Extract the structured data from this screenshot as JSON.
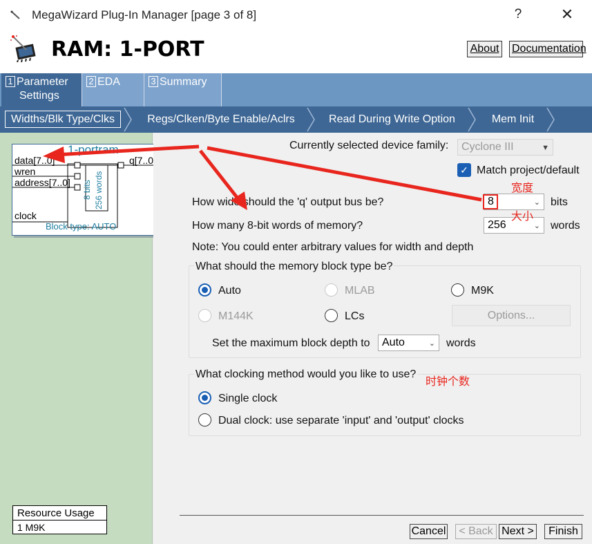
{
  "window": {
    "title": "MegaWizard Plug-In Manager [page 3 of 8]",
    "help": "?",
    "close": "✕"
  },
  "header": {
    "heading": "RAM: 1-PORT",
    "about": "About",
    "documentation": "Documentation"
  },
  "tabs": [
    {
      "num": "1",
      "label1": "Parameter",
      "label2": "Settings"
    },
    {
      "num": "2",
      "label1": "EDA"
    },
    {
      "num": "3",
      "label1": "Summary"
    }
  ],
  "subtabs": [
    "Widths/Blk Type/Clks",
    "Regs/Clken/Byte Enable/Aclrs",
    "Read During Write Option",
    "Mem Init"
  ],
  "symbol": {
    "title": "1-portram",
    "data": "data[7..0]",
    "wren": "wren",
    "address": "address[7..0]",
    "clock": "clock",
    "q": "q[7..0]",
    "bits": "8 bits",
    "words": "256 words",
    "block_type": "Block type: AUTO"
  },
  "resource": {
    "label": "Resource Usage",
    "value": "1 M9K"
  },
  "device": {
    "label": "Currently selected device family:",
    "value": "Cyclone III",
    "match_label": "Match project/default",
    "match_checked": true
  },
  "width": {
    "label": "How wide should the 'q' output bus be?",
    "value": "8",
    "unit": "bits"
  },
  "depth": {
    "label": "How many 8-bit words of memory?",
    "value": "256",
    "unit": "words"
  },
  "note": "Note: You could enter arbitrary values for width and depth",
  "memory_block": {
    "label": "What should the memory block type be?",
    "auto": "Auto",
    "mlab": "MLAB",
    "m9k": "M9K",
    "m144k": "M144K",
    "lcs": "LCs",
    "options": "Options...",
    "max_depth_label": "Set the maximum block depth to",
    "max_depth_value": "Auto",
    "max_depth_unit": "words"
  },
  "clocking": {
    "label": "What clocking method would you like to use?",
    "single": "Single clock",
    "dual": "Dual clock: use separate 'input' and 'output' clocks"
  },
  "annotations": {
    "width": "宽度",
    "size": "大小",
    "clocks": "时钟个数"
  },
  "buttons": {
    "cancel": "Cancel",
    "back": "< Back",
    "next": "Next >",
    "finish": "Finish"
  },
  "colors": {
    "tab_active": "#3e6795",
    "tab_bar": "#6d97c3",
    "left_panel": "#c5dcc1",
    "annotation": "#e8261e",
    "radio_selected": "#1a5fb4"
  }
}
